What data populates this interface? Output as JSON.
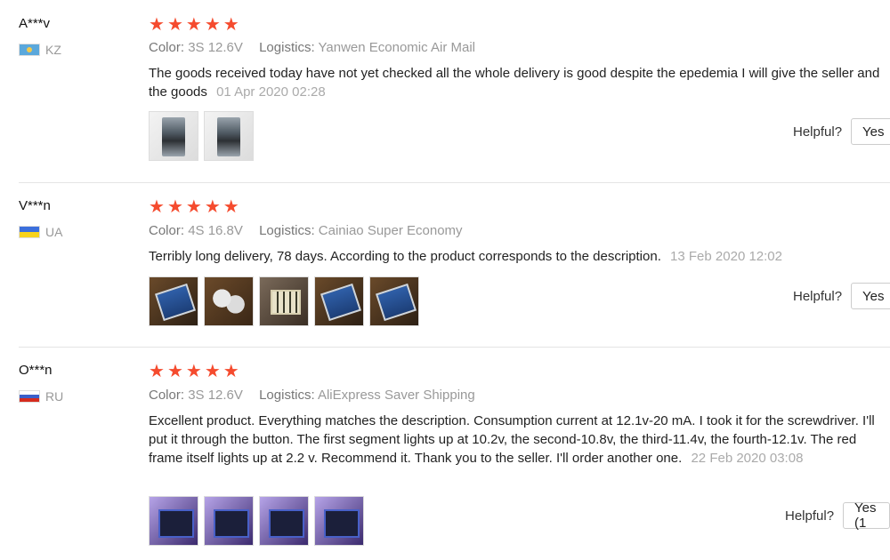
{
  "colors": {
    "star": "#f54b2e",
    "meta": "#999999",
    "divider": "#e4e4e4"
  },
  "reviews": [
    {
      "user": "A***v",
      "country": "KZ",
      "flag_icon": "kazakhstan-flag-icon",
      "stars": 5,
      "color_label": "Color:",
      "color_value": "3S 12.6V",
      "logistics_label": "Logistics:",
      "logistics_value": "Yanwen Economic Air Mail",
      "text": "The goods received today have not yet checked all the whole delivery is good despite the epedemia I will give the seller and the goods",
      "date": "01 Apr 2020 02:28",
      "photos": 2,
      "helpful_label": "Helpful?",
      "yes_label": "Yes"
    },
    {
      "user": "V***n",
      "country": "UA",
      "flag_icon": "ukraine-flag-icon",
      "stars": 5,
      "color_label": "Color:",
      "color_value": "4S 16.8V",
      "logistics_label": "Logistics:",
      "logistics_value": "Cainiao Super Economy",
      "text": "Terribly long delivery, 78 days. According to the product corresponds to the description.",
      "date": "13 Feb 2020 12:02",
      "photos": 5,
      "helpful_label": "Helpful?",
      "yes_label": "Yes"
    },
    {
      "user": "O***n",
      "country": "RU",
      "flag_icon": "russia-flag-icon",
      "stars": 5,
      "color_label": "Color:",
      "color_value": "3S 12.6V",
      "logistics_label": "Logistics:",
      "logistics_value": "AliExpress Saver Shipping",
      "text": "Excellent product. Everything matches the description. Consumption current at 12.1v-20 mA. I took it for the screwdriver. I'll put it through the button. The first segment lights up at 10.2v, the second-10.8v, the third-11.4v, the fourth-12.1v. The red frame itself lights up at 2.2 v. Recommend it. Thank you to the seller. I'll order another one.",
      "date": "22 Feb 2020 03:08",
      "photos": 4,
      "helpful_label": "Helpful?",
      "yes_label": "Yes (1"
    }
  ]
}
